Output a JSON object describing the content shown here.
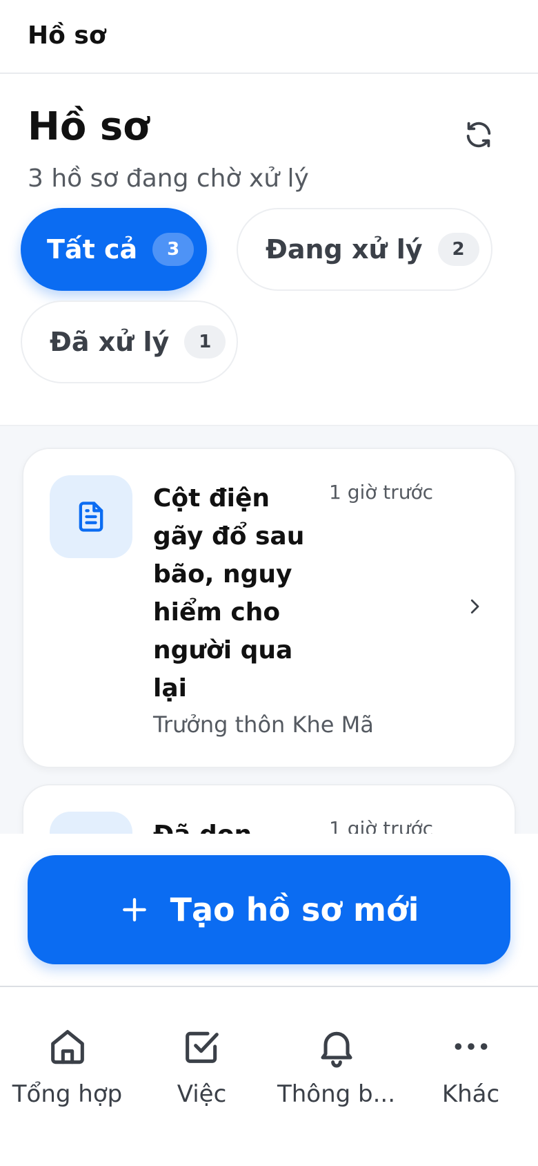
{
  "app_bar": {
    "title": "Hồ sơ"
  },
  "header": {
    "title": "Hồ sơ",
    "subtitle": "3 hồ sơ đang chờ xử lý",
    "refresh_icon": "refresh-icon"
  },
  "filters": [
    {
      "label": "Tất cả",
      "count": "3",
      "active": true
    },
    {
      "label": "Đang xử lý",
      "count": "2",
      "active": false
    },
    {
      "label": "Đã xử lý",
      "count": "1",
      "active": false
    }
  ],
  "cases": [
    {
      "icon": "document-icon",
      "title": "Cột điện gãy đổ sau bão, nguy hiểm cho người qua lại",
      "time": "1 giờ trước",
      "author": "Trưởng thôn Khe Mã"
    },
    {
      "icon": "document-icon",
      "title": "Đã dọn",
      "time": "1 giờ trước",
      "author": ""
    }
  ],
  "primary_action": {
    "label": "Tạo hồ sơ mới",
    "icon": "plus-icon"
  },
  "bottom_nav": [
    {
      "label": "Tổng hợp",
      "icon": "home-icon"
    },
    {
      "label": "Việc",
      "icon": "checkbox-icon"
    },
    {
      "label": "Thông b...",
      "icon": "bell-icon"
    },
    {
      "label": "Khác",
      "icon": "more-icon"
    }
  ],
  "colors": {
    "accent": "#0b6cf2",
    "text_primary": "#111111",
    "text_secondary": "#555a61",
    "list_background": "#f5f7fa",
    "icon_box": "#e3effd"
  }
}
